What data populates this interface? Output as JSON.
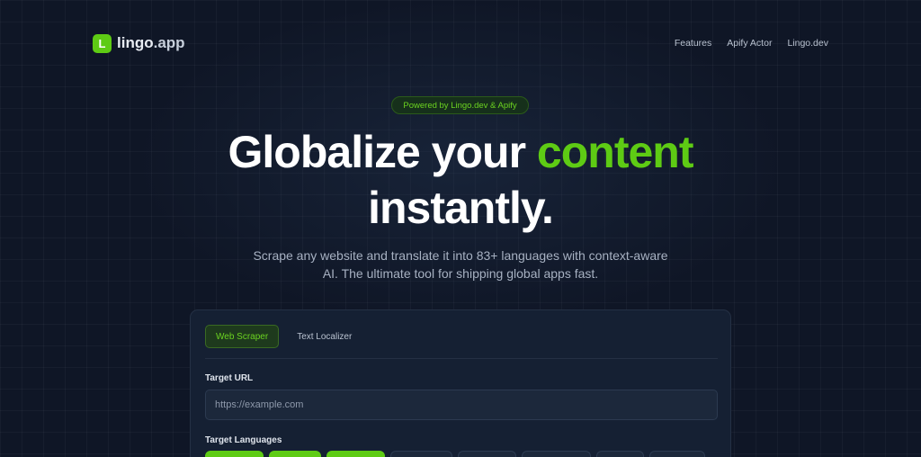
{
  "brand": {
    "name_main": "lingo",
    "name_suffix": ".app",
    "logo_letter": "L",
    "accent_color": "#5ecb14"
  },
  "nav": {
    "links": [
      "Features",
      "Apify Actor",
      "Lingo.dev"
    ]
  },
  "hero": {
    "badge": "Powered by Lingo.dev & Apify",
    "headline_part1": "Globalize your ",
    "headline_accent": "content",
    "headline_part2": "instantly.",
    "subtitle": "Scrape any website and translate it into 83+ languages with context-aware AI. The ultimate tool for shipping global apps fast."
  },
  "card": {
    "tabs": [
      {
        "label": "Web Scraper",
        "active": true
      },
      {
        "label": "Text Localizer",
        "active": false
      }
    ],
    "url_label": "Target URL",
    "url_placeholder": "https://example.com",
    "languages_label": "Target Languages",
    "language_chips": [
      {
        "selected": true
      },
      {
        "selected": true
      },
      {
        "selected": true
      },
      {
        "selected": false
      },
      {
        "selected": false
      },
      {
        "selected": false
      },
      {
        "selected": false
      },
      {
        "selected": false
      }
    ]
  }
}
